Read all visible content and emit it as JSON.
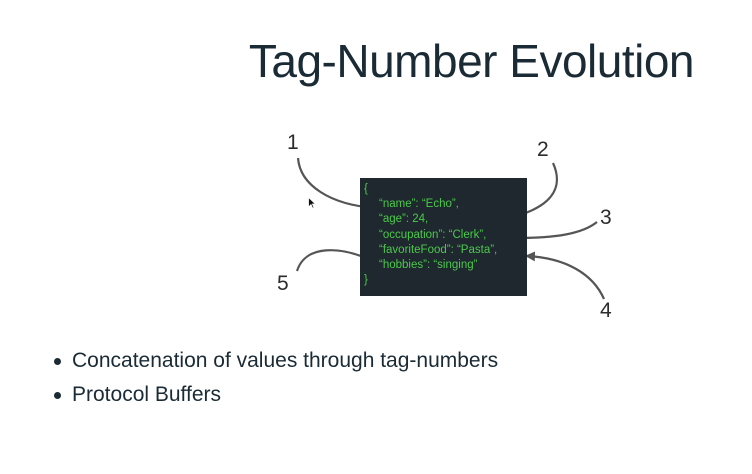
{
  "slide": {
    "title": "Tag-Number Evolution",
    "code_lines": [
      "{",
      "“name”: “Echo”,",
      "“age”: 24,",
      "“occupation”: “Clerk”,",
      "“favoriteFood”: “Pasta”,",
      "“hobbies”: “singing”",
      "}"
    ],
    "callouts": [
      "1",
      "2",
      "3",
      "4",
      "5"
    ],
    "bullets": [
      "Concatenation of values through tag-numbers",
      "Protocol Buffers"
    ],
    "colors": {
      "title": "#1b2b35",
      "code_background": "#1e282e",
      "code_text": "#4bc94b",
      "arrow": "#555555"
    },
    "icons": [
      "mouse-cursor-icon",
      "bullet-dot-icon"
    ]
  }
}
